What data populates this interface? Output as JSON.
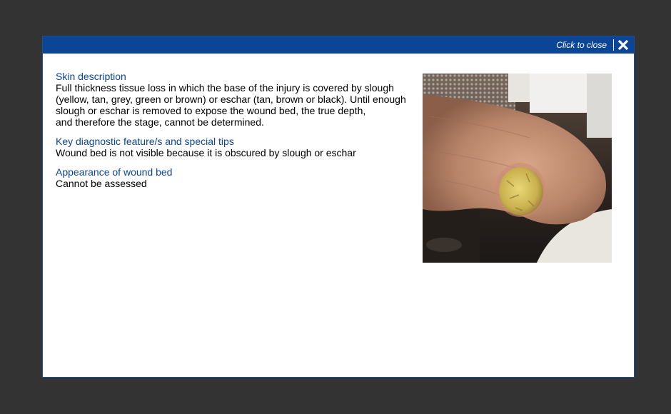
{
  "header": {
    "close_label": "Click to close"
  },
  "sections": [
    {
      "title": "Skin description",
      "text": "Full thickness tissue loss in which the base of the injury is covered by slough\n(yellow, tan, grey, green or brown) or eschar (tan, brown or black). Until enough\nslough or eschar is removed to expose the wound bed, the true depth,\nand therefore the stage, cannot be determined."
    },
    {
      "title": "Key diagnostic feature/s and special tips",
      "text": "Wound bed is not visible because it is obscured by slough or eschar"
    },
    {
      "title": "Appearance of wound bed",
      "text": "Cannot be assessed"
    }
  ],
  "colors": {
    "header_bg": "#0c4596",
    "title": "#0c4596",
    "backdrop": "#333333"
  },
  "icons": {
    "close": "close-icon"
  }
}
